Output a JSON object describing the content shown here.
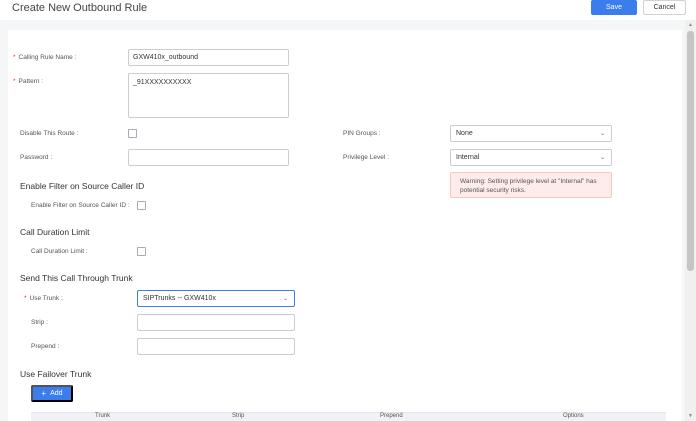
{
  "header": {
    "title": "Create New Outbound Rule",
    "save_label": "Save",
    "cancel_label": "Cancel"
  },
  "form": {
    "calling_rule_name": {
      "label": "Calling Rule Name :",
      "value": "GXW410x_outbound",
      "required": true
    },
    "pattern": {
      "label": "Pattern :",
      "value": "_91XXXXXXXXXX",
      "required": true
    },
    "disable_this_route": {
      "label": "Disable This Route :",
      "checked": false
    },
    "password": {
      "label": "Password :",
      "value": ""
    },
    "pin_groups": {
      "label": "PIN Groups :",
      "value": "None"
    },
    "privilege_level": {
      "label": "Privilege Level :",
      "value": "Internal"
    },
    "warning_text": "Warning: Setting privilege level at \"Internal\" has potential security risks."
  },
  "sections": {
    "enable_filter": {
      "title": "Enable Filter on Source Caller ID",
      "checkbox_label": "Enable Filter on Source Caller ID :",
      "checked": false
    },
    "call_duration": {
      "title": "Call Duration Limit",
      "checkbox_label": "Call Duration Limit :",
      "checked": false
    },
    "send_through_trunk": {
      "title": "Send This Call Through Trunk",
      "use_trunk_label": "Use Trunk :",
      "use_trunk_value": "SIPTrunks -- GXW410x",
      "strip_label": "Strip :",
      "strip_value": "",
      "prepend_label": "Prepend :",
      "prepend_value": ""
    },
    "failover_trunk": {
      "title": "Use Failover Trunk",
      "add_label": "Add",
      "columns": [
        "Trunk",
        "Strip",
        "Prepend",
        "Options"
      ]
    }
  },
  "icons": {
    "chevron": "chevron-down-icon",
    "plus": "plus-icon"
  },
  "colors": {
    "primary": "#3b7ded",
    "required": "#e0362c",
    "warning_bg": "#fdecea"
  }
}
